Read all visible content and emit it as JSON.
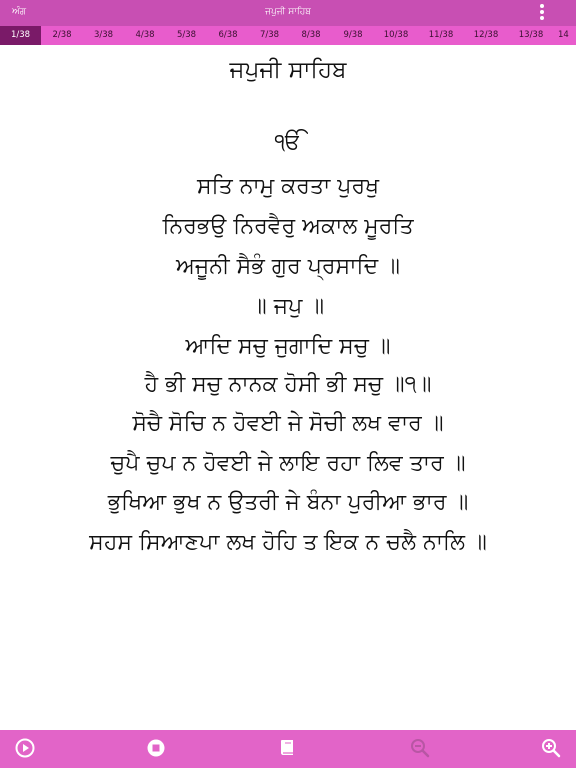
{
  "header": {
    "back_label": "ਅੰਗ",
    "title": "ਜਪੁਜੀ ਸਾਹਿਬ",
    "more_icon": "more-vertical-icon"
  },
  "pages": {
    "current": 1,
    "total": 38,
    "labels": [
      "1/38",
      "2/38",
      "3/38",
      "4/38",
      "5/38",
      "6/38",
      "7/38",
      "8/38",
      "9/38",
      "10/38",
      "11/38",
      "12/38",
      "13/38",
      "14"
    ]
  },
  "content": {
    "heading": "ਜਪੁਜੀ ਸਾਹਿਬ",
    "lines": [
      "ੴ",
      "ਸਤਿ ਨਾਮੁ ਕਰਤਾ ਪੁਰਖੁ",
      "ਨਿਰਭਉ ਨਿਰਵੈਰੁ ਅਕਾਲ ਮੂਰਤਿ",
      "ਅਜੂਨੀ ਸੈਭੰ ਗੁਰ ਪ੍ਰਸਾਦਿ ॥",
      "॥ ਜਪੁ ॥",
      "ਆਦਿ ਸਚੁ ਜੁਗਾਦਿ ਸਚੁ ॥",
      "ਹੈ ਭੀ ਸਚੁ ਨਾਨਕ ਹੋਸੀ ਭੀ ਸਚੁ ॥੧॥",
      "ਸੋਚੈ ਸੋਚਿ ਨ ਹੋਵਈ ਜੇ ਸੋਚੀ ਲਖ ਵਾਰ ॥",
      "ਚੁਪੈ ਚੁਪ ਨ ਹੋਵਈ ਜੇ ਲਾਇ ਰਹਾ ਲਿਵ ਤਾਰ ॥",
      "ਭੁਖਿਆ ਭੁਖ ਨ ਉਤਰੀ ਜੇ ਬੰਨਾ ਪੁਰੀਆ ਭਾਰ ॥",
      "ਸਹਸ ਸਿਆਣਪਾ ਲਖ ਹੋਹਿ ਤ ਇਕ ਨ ਚਲੈ ਨਾਲਿ ॥"
    ]
  },
  "toolbar": {
    "icons": [
      "play-icon",
      "stop-icon",
      "book-icon",
      "zoom-out-icon",
      "zoom-in-icon"
    ]
  },
  "colors": {
    "topbar": "#c84fb3",
    "pagebar": "#e85ccc",
    "active_page": "#7a1a68",
    "bottombar": "#e264c8",
    "icon_disabled": "#b856a4"
  }
}
